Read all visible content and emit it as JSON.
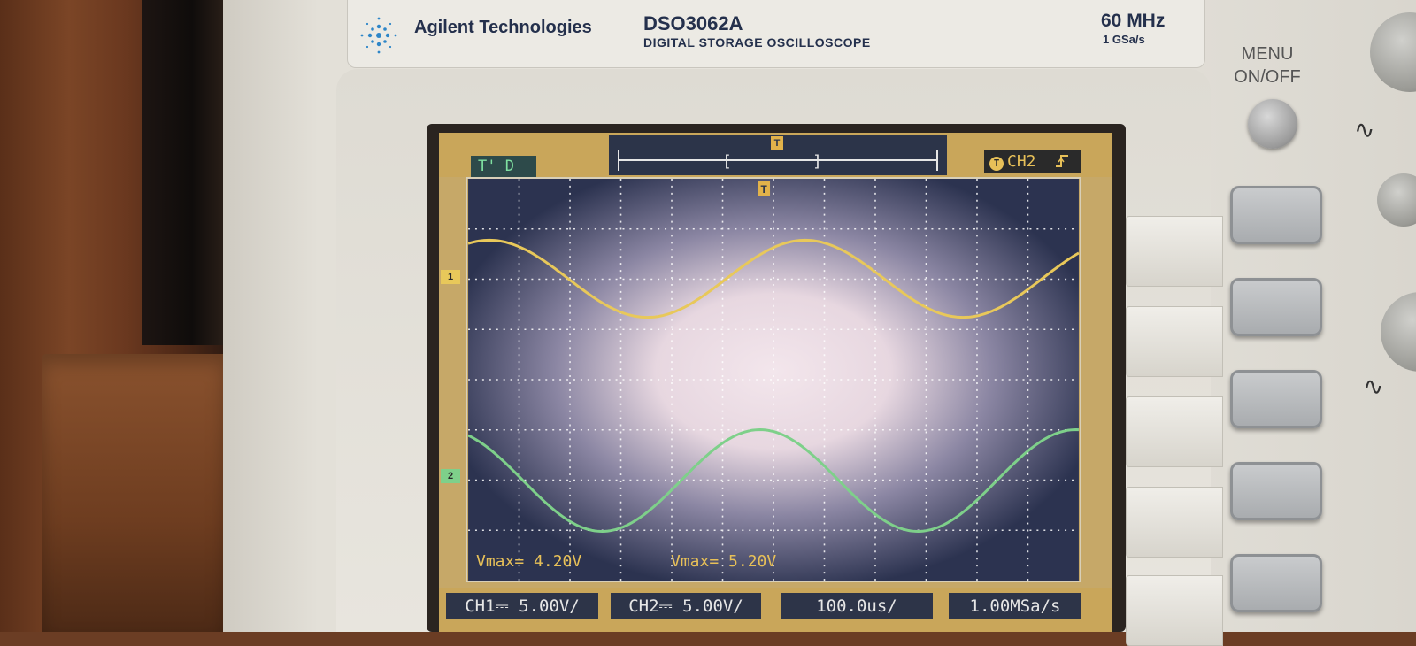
{
  "header": {
    "brand": "Agilent Technologies",
    "model": "DSO3062A",
    "model_description": "DIGITAL STORAGE OSCILLOSCOPE",
    "bandwidth": "60 MHz",
    "sample_rate": "1 GSa/s"
  },
  "controls": {
    "menu_label_line1": "MENU",
    "menu_label_line2": "ON/OFF",
    "softkey_count": 5
  },
  "display": {
    "trigger_status": "T' D",
    "trigger_marker": "T",
    "trigger_source": "CH2",
    "trigger_slope_icon": "rising-edge-icon",
    "channel1_marker": "1",
    "channel2_marker": "2",
    "measurements": [
      {
        "label": "Vmax= 4.20V"
      },
      {
        "label": "Vmax= 5.20V"
      }
    ],
    "status": {
      "ch1": "CH1⎓ 5.00V/",
      "ch2": "CH2⎓ 5.00V/",
      "timebase": "100.0us/",
      "sample_rate": "1.00MSa/s"
    },
    "colors": {
      "ch1_trace": "#e8c85a",
      "ch2_trace": "#7ed08a",
      "screen_bg": "#2c3350"
    }
  }
}
